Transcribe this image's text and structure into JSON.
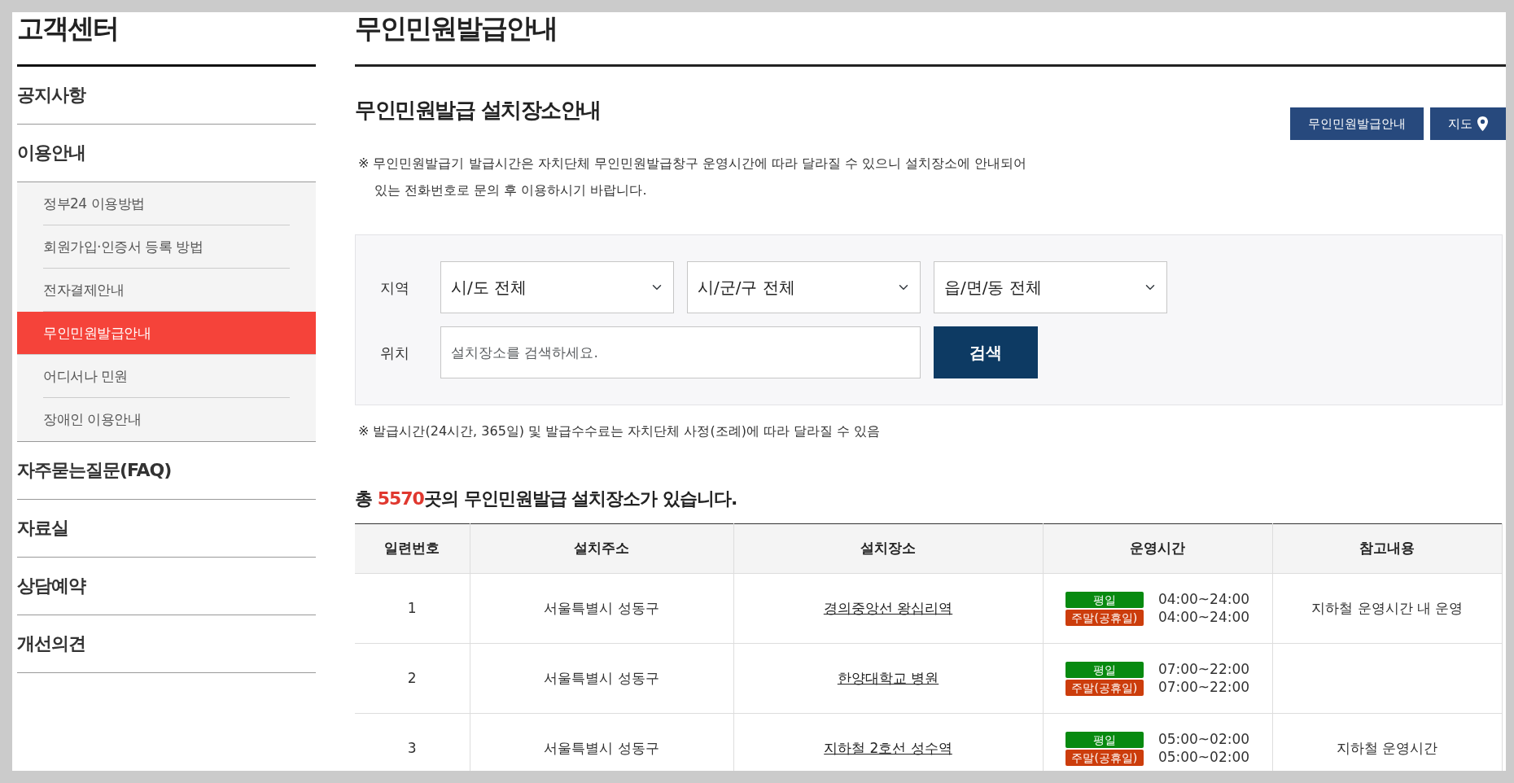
{
  "sidebar": {
    "title": "고객센터",
    "items": [
      {
        "label": "공지사항"
      },
      {
        "label": "이용안내",
        "children": [
          {
            "label": "정부24 이용방법",
            "selected": false
          },
          {
            "label": "회원가입·인증서 등록 방법",
            "selected": false
          },
          {
            "label": "전자결제안내",
            "selected": false
          },
          {
            "label": "무인민원발급안내",
            "selected": true
          },
          {
            "label": "어디서나 민원",
            "selected": false
          },
          {
            "label": "장애인 이용안내",
            "selected": false
          }
        ]
      },
      {
        "label": "자주묻는질문(FAQ)"
      },
      {
        "label": "자료실"
      },
      {
        "label": "상담예약"
      },
      {
        "label": "개선의견"
      }
    ]
  },
  "page_title": "무인민원발급안내",
  "section_title": "무인민원발급 설치장소안내",
  "header_buttons": [
    {
      "label": "무인민원발급안내",
      "kind": "text"
    },
    {
      "label": "지도",
      "kind": "map"
    }
  ],
  "notice": [
    "※ 무인민원발급기 발급시간은 자치단체 무인민원발급창구 운영시간에 따라 달라질 수 있으니 설치장소에 안내되어",
    "있는 전화번호로 문의 후 이용하시기 바랍니다."
  ],
  "search": {
    "region_label": "지역",
    "selects": [
      "시/도 전체",
      "시/군/구 전체",
      "읍/면/동 전체"
    ],
    "location_label": "위치",
    "placeholder": "설치장소를 검색하세요.",
    "button": "검색"
  },
  "fee_note": "※ 발급시간(24시간, 365일) 및 발급수수료는 자치단체 사정(조례)에 따라 달라질 수 있음",
  "summary": "총 **5570**곳의 무인민원발급 설치장소가 있습니다.",
  "table": {
    "columns": [
      "일련번호",
      "설치주소",
      "설치장소",
      "운영시간",
      "참고내용"
    ],
    "rows": [
      {
        "no": "1",
        "address": "서울특별시 성동구",
        "place": "경의중앙선 왕십리역",
        "hours": [
          {
            "tag": "평일",
            "color": "#078a10",
            "time": "04:00~24:00"
          },
          {
            "tag": "주말(공휴일)",
            "color": "#cc3d0c",
            "time": "04:00~24:00"
          }
        ],
        "note": "지하철 운영시간 내 운영"
      },
      {
        "no": "2",
        "address": "서울특별시 성동구",
        "place": "한양대학교 병원",
        "hours": [
          {
            "tag": "평일",
            "color": "#078a10",
            "time": "07:00~22:00"
          },
          {
            "tag": "주말(공휴일)",
            "color": "#cc3d0c",
            "time": "07:00~22:00"
          }
        ]
      },
      {
        "no": "3",
        "address": "서울특별시 성동구",
        "place": "지하철 2호선 성수역",
        "hours": [
          {
            "tag": "평일",
            "color": "#078a10",
            "time": "05:00~02:00"
          },
          {
            "tag": "주말(공휴일)",
            "color": "#cc3d0c",
            "time": "05:00~02:00"
          }
        ],
        "note": "지하철 운영시간"
      }
    ]
  }
}
